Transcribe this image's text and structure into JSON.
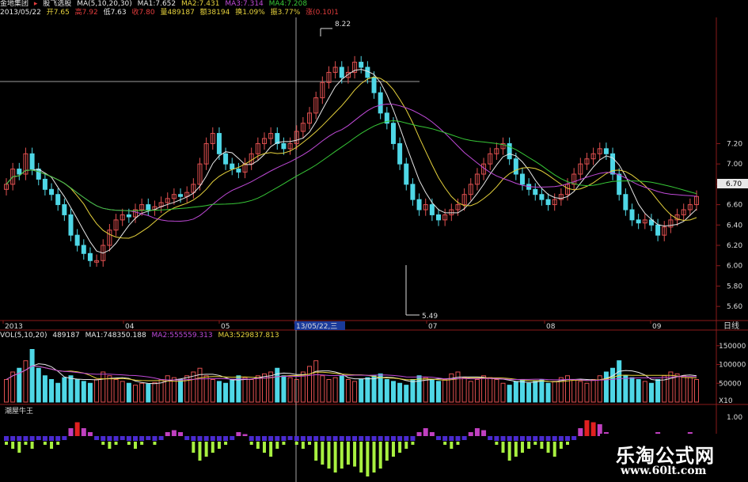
{
  "header": {
    "stock_name": "金地集团",
    "formula_name": "股飞选股",
    "ma_params": "MA(5,10,20,30)",
    "ma1": "MA1:7.652",
    "ma2": "MA2:7.431",
    "ma3": "MA3:7.314",
    "ma4": "MA4:7.208",
    "date": "2013/05/22",
    "open": "开7.65",
    "high": "高7.92",
    "low": "低7.63",
    "close": "收7.80",
    "volume": "量489187",
    "amount": "额38194",
    "turnover": "换1.09%",
    "amplitude": "振3.77%",
    "extra": "涨(0.10)1"
  },
  "price_chart": {
    "y_ticks": [
      "7.20",
      "7.00",
      "6.80",
      "6.60",
      "6.40",
      "6.20",
      "6.00",
      "5.80",
      "5.60"
    ],
    "current_price_tag": "6.70",
    "high_marker": "8.22",
    "low_marker": "5.49",
    "period_label": "日线"
  },
  "time_axis": {
    "labels": [
      "2013",
      "04",
      "05",
      "13/05/22,三",
      "07",
      "08",
      "09"
    ]
  },
  "volume_panel": {
    "header": {
      "params": "VOL(5,10,20)",
      "value": "489187",
      "ma1": "MA1:748350.188",
      "ma2": "MA2:555559.313",
      "ma3": "MA3:529837.813"
    },
    "y_ticks": [
      "150000",
      "100000",
      "50000"
    ],
    "unit": "X10"
  },
  "indicator_panel": {
    "name": "潮屋牛王",
    "y_tick": "1.00"
  },
  "watermark": {
    "title": "乐淘公式网",
    "url": "www.60lt.com"
  },
  "colors": {
    "up": "#e05050",
    "down": "#4fd7e6",
    "ma1": "#e8e8e8",
    "ma2": "#e6d23c",
    "ma3": "#c04ad8",
    "ma4": "#37c837",
    "ind_pos_red": "#e02020",
    "ind_pos_purple": "#c040c0",
    "ind_neg_blue": "#4a2ad0",
    "ind_neg_green": "#a8f040"
  },
  "chart_data": {
    "type": "candlestick",
    "y_range_price": [
      5.5,
      8.3
    ],
    "closes": [
      6.8,
      6.95,
      6.9,
      7.1,
      6.95,
      6.85,
      6.75,
      6.7,
      6.6,
      6.5,
      6.3,
      6.2,
      6.12,
      6.05,
      6.05,
      6.2,
      6.35,
      6.45,
      6.5,
      6.48,
      6.55,
      6.6,
      6.55,
      6.58,
      6.62,
      6.66,
      6.7,
      6.68,
      6.72,
      6.8,
      7.0,
      7.2,
      7.3,
      7.1,
      7.0,
      6.95,
      6.92,
      7.0,
      7.1,
      7.2,
      7.25,
      7.3,
      7.2,
      7.15,
      7.2,
      7.32,
      7.4,
      7.5,
      7.65,
      7.8,
      7.9,
      7.95,
      7.85,
      7.9,
      8.0,
      7.95,
      7.85,
      7.7,
      7.5,
      7.4,
      7.2,
      7.0,
      6.8,
      6.65,
      6.55,
      6.6,
      6.5,
      6.45,
      6.5,
      6.55,
      6.6,
      6.7,
      6.8,
      6.9,
      7.0,
      7.1,
      7.15,
      7.2,
      7.05,
      6.9,
      6.8,
      6.75,
      6.7,
      6.65,
      6.6,
      6.65,
      6.7,
      6.8,
      6.9,
      7.0,
      7.05,
      7.1,
      7.15,
      7.1,
      6.9,
      6.7,
      6.55,
      6.45,
      6.42,
      6.45,
      6.4,
      6.3,
      6.38,
      6.45,
      6.5,
      6.55,
      6.6,
      6.68
    ],
    "volumes": [
      60000,
      80000,
      90000,
      110000,
      140000,
      90000,
      70000,
      60000,
      50000,
      65000,
      70000,
      60000,
      55000,
      50000,
      60000,
      80000,
      70000,
      60000,
      55000,
      50000,
      45000,
      50000,
      48000,
      52000,
      60000,
      70000,
      65000,
      60000,
      70000,
      80000,
      90000,
      70000,
      60000,
      55000,
      50000,
      60000,
      70000,
      65000,
      60000,
      70000,
      75000,
      80000,
      90000,
      70000,
      65000,
      60000,
      80000,
      95000,
      110000,
      70000,
      60000,
      65000,
      70000,
      60000,
      55000,
      60000,
      65000,
      70000,
      75000,
      60000,
      55000,
      50000,
      45000,
      60000,
      70000,
      65000,
      60000,
      55000,
      60000,
      75000,
      80000,
      65000,
      55000,
      60000,
      70000,
      65000,
      60000,
      50000,
      45000,
      55000,
      60000,
      50000,
      55000,
      60000,
      50000,
      55000,
      65000,
      70000,
      60000,
      55000,
      50000,
      60000,
      70000,
      80000,
      90000,
      110000,
      70000,
      65000,
      60000,
      55000,
      50000,
      60000,
      70000,
      80000,
      75000,
      70000,
      65000,
      60000
    ],
    "indicator": [
      -0.2,
      -0.3,
      -0.4,
      -0.2,
      -0.3,
      -0.1,
      -0.2,
      -0.3,
      -0.2,
      -0.1,
      0.2,
      0.35,
      0.2,
      0.1,
      -0.1,
      -0.2,
      -0.3,
      -0.2,
      -0.1,
      -0.2,
      -0.3,
      -0.2,
      -0.1,
      -0.2,
      -0.1,
      0.1,
      0.15,
      0.1,
      -0.1,
      -0.4,
      -0.6,
      -0.5,
      -0.4,
      -0.3,
      -0.2,
      -0.1,
      0.1,
      0.05,
      -0.2,
      -0.3,
      -0.4,
      -0.5,
      -0.3,
      -0.2,
      -0.1,
      -0.2,
      -0.3,
      -0.2,
      -0.6,
      -0.7,
      -0.8,
      -0.9,
      -0.8,
      -0.7,
      -0.75,
      -0.9,
      -1.0,
      -0.9,
      -0.8,
      -0.6,
      -0.5,
      -0.4,
      -0.3,
      -0.2,
      0.1,
      0.2,
      0.1,
      -0.1,
      -0.2,
      -0.3,
      -0.2,
      -0.1,
      0.1,
      0.2,
      0.15,
      -0.1,
      -0.2,
      -0.4,
      -0.6,
      -0.5,
      -0.4,
      -0.3,
      -0.2,
      -0.3,
      -0.4,
      -0.5,
      -0.3,
      -0.2,
      -0.1,
      0.2,
      0.4,
      0.35,
      0.3,
      0.1,
      -0.2,
      -0.4,
      -0.5,
      -0.3,
      -0.2,
      -0.1,
      0.05,
      0.1,
      0.05,
      -0.1,
      -0.1,
      0.05,
      0.1,
      0.05
    ]
  }
}
